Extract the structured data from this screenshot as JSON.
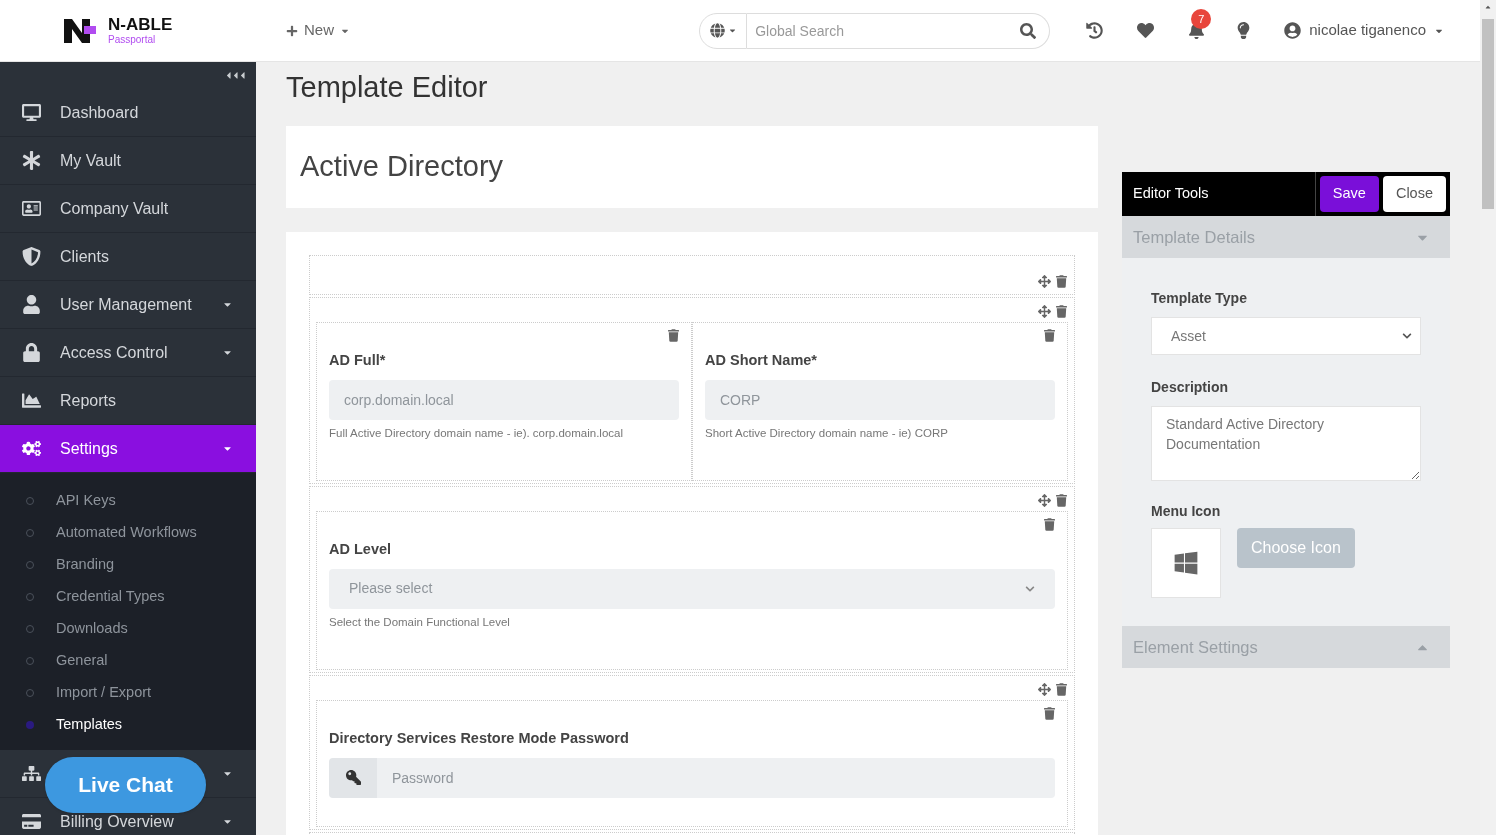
{
  "header": {
    "logo": {
      "name": "N-ABLE",
      "subtitle": "Passportal"
    },
    "new_button": "New",
    "search": {
      "placeholder": "Global Search"
    },
    "notifications_count": "7",
    "user": "nicolae tiganenco"
  },
  "sidebar": {
    "items": [
      {
        "label": "Dashboard",
        "selected": false,
        "expandable": false
      },
      {
        "label": "My Vault",
        "selected": false,
        "expandable": false
      },
      {
        "label": "Company Vault",
        "selected": false,
        "expandable": false
      },
      {
        "label": "Clients",
        "selected": false,
        "expandable": false
      },
      {
        "label": "User Management",
        "selected": false,
        "expandable": true
      },
      {
        "label": "Access Control",
        "selected": false,
        "expandable": true
      },
      {
        "label": "Reports",
        "selected": false,
        "expandable": false
      },
      {
        "label": "Settings",
        "selected": true,
        "expandable": true,
        "expanded": true,
        "children": [
          {
            "label": "API Keys",
            "selected": false
          },
          {
            "label": "Automated Workflows",
            "selected": false
          },
          {
            "label": "Branding",
            "selected": false
          },
          {
            "label": "Credential Types",
            "selected": false
          },
          {
            "label": "Downloads",
            "selected": false
          },
          {
            "label": "General",
            "selected": false
          },
          {
            "label": "Import / Export",
            "selected": false
          },
          {
            "label": "Templates",
            "selected": true
          }
        ]
      },
      {
        "selected": false,
        "expandable": true
      },
      {
        "label": "Billing Overview",
        "selected": false,
        "expandable": true
      }
    ]
  },
  "live_chat": "Live Chat",
  "page_title": "Template Editor",
  "template_name": "Active Directory",
  "builder": {
    "rows": [
      {
        "columns": []
      },
      {
        "columns": [
          {
            "kind": "text",
            "label": "AD Full*",
            "placeholder": "corp.domain.local",
            "help": "Full Active Directory domain name - ie). corp.domain.local"
          },
          {
            "kind": "text",
            "label": "AD Short Name*",
            "placeholder": "CORP",
            "help": "Short Active Directory domain name - ie) CORP"
          }
        ]
      },
      {
        "columns": [
          {
            "kind": "select",
            "label": "AD Level",
            "placeholder": "Please select",
            "help": "Select the Domain Functional Level"
          }
        ]
      },
      {
        "columns": [
          {
            "kind": "password",
            "label": "Directory Services Restore Mode Password",
            "placeholder": "Password"
          }
        ]
      },
      {
        "columns": []
      }
    ]
  },
  "editor_tools": {
    "title": "Editor Tools",
    "buttons": [
      {
        "label": "Save",
        "kind": "primary"
      },
      {
        "label": "Close",
        "kind": "secondary"
      }
    ],
    "sections": [
      {
        "title": "Template Details",
        "expanded": true,
        "template_type": {
          "label": "Template Type",
          "value": "Asset"
        },
        "description": {
          "label": "Description",
          "value": "Standard Active Directory Documentation"
        },
        "menu_icon": {
          "label": "Menu Icon",
          "button": "Choose Icon",
          "disabled": true
        }
      },
      {
        "title": "Element Settings",
        "expanded": false
      }
    ]
  }
}
